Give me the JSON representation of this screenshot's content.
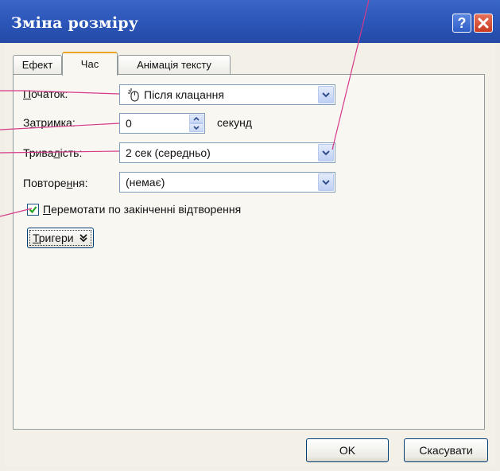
{
  "window": {
    "title": "Зміна розміру",
    "help_label": "?"
  },
  "tabs": [
    {
      "label": "Ефект"
    },
    {
      "label": "Час"
    },
    {
      "label": "Анімація тексту"
    }
  ],
  "form": {
    "start": {
      "label_hotkey": "П",
      "label_rest": "очаток:",
      "value": "Після клацання"
    },
    "delay": {
      "label_pre": "З",
      "label_hotkey": "а",
      "label_rest": "тримка:",
      "value": "0",
      "unit": "секунд"
    },
    "duration": {
      "label_pre": "Трива",
      "label_hotkey": "л",
      "label_rest": "ість:",
      "value": "2 сек (середньо)"
    },
    "repeat": {
      "label_pre": "Повторе",
      "label_hotkey": "н",
      "label_rest": "ня:",
      "value": "(немає)"
    },
    "rewind": {
      "checked": true,
      "label_hotkey": "П",
      "label_rest": "еремотати по закінченні відтворення"
    },
    "triggers": {
      "label_hotkey": "Т",
      "label_rest": "ригери"
    }
  },
  "buttons": {
    "ok": "OK",
    "cancel": "Скасувати"
  },
  "colors": {
    "titlebar": "#2b55b8",
    "leader_lines": "#d63a8a"
  }
}
